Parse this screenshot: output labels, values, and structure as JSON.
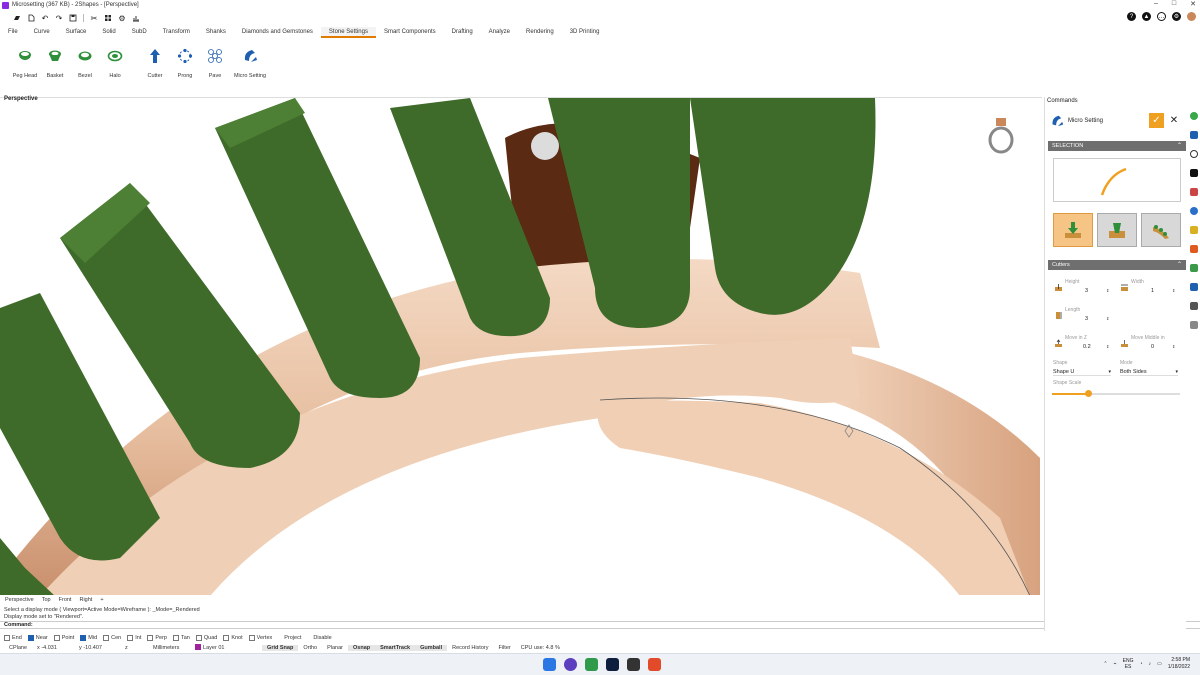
{
  "window": {
    "title": "Microsetting (367 KB) - 2Shapes - [Perspective]",
    "controls": [
      "–",
      "□",
      "✕"
    ]
  },
  "ribbon": {
    "tabs": [
      {
        "label": "File",
        "active": false
      },
      {
        "label": "Curve",
        "active": false
      },
      {
        "label": "Surface",
        "active": false
      },
      {
        "label": "Solid",
        "active": false
      },
      {
        "label": "SubD",
        "active": false
      },
      {
        "label": "Transform",
        "active": false
      },
      {
        "label": "Shanks",
        "active": false
      },
      {
        "label": "Diamonds and Gemstones",
        "active": false
      },
      {
        "label": "Stone Settings",
        "active": true
      },
      {
        "label": "Smart Components",
        "active": false
      },
      {
        "label": "Drafting",
        "active": false
      },
      {
        "label": "Analyze",
        "active": false
      },
      {
        "label": "Rendering",
        "active": false
      },
      {
        "label": "3D Printing",
        "active": false
      }
    ],
    "commands": [
      {
        "label": "Peg Head",
        "icon": "peg-head-icon"
      },
      {
        "label": "Basket",
        "icon": "basket-icon"
      },
      {
        "label": "Bezel",
        "icon": "bezel-icon"
      },
      {
        "label": "Halo",
        "icon": "halo-icon"
      },
      {
        "label": "Cutter",
        "icon": "cutter-icon"
      },
      {
        "label": "Prong",
        "icon": "prong-icon"
      },
      {
        "label": "Pave",
        "icon": "pave-icon"
      },
      {
        "label": "Micro Setting",
        "icon": "micro-setting-icon"
      }
    ]
  },
  "viewport": {
    "label": "Perspective",
    "tabs": [
      "Perspective",
      "Top",
      "Front",
      "Right",
      "+"
    ]
  },
  "history": {
    "line1": "Select a display mode ( Viewport=Active  Mode=Wireframe ): _Mode=_Rendered",
    "line2": "Display mode set to \"Rendered\"."
  },
  "command_prompt": "Command:",
  "osnap": [
    {
      "label": "End",
      "checked": false
    },
    {
      "label": "Near",
      "checked": true
    },
    {
      "label": "Point",
      "checked": false
    },
    {
      "label": "Mid",
      "checked": true
    },
    {
      "label": "Cen",
      "checked": false
    },
    {
      "label": "Int",
      "checked": false
    },
    {
      "label": "Perp",
      "checked": false
    },
    {
      "label": "Tan",
      "checked": false
    },
    {
      "label": "Quad",
      "checked": false
    },
    {
      "label": "Knot",
      "checked": false
    },
    {
      "label": "Vertex",
      "checked": false
    }
  ],
  "osnap_extra": [
    "Project",
    "Disable"
  ],
  "status": {
    "cplane": "CPlane",
    "x": "x -4.031",
    "y": "y -10.407",
    "z": "z",
    "units": "Millimeters",
    "layer": "Layer 01",
    "toggles": [
      {
        "label": "Grid Snap",
        "on": true
      },
      {
        "label": "Ortho",
        "on": false
      },
      {
        "label": "Planar",
        "on": false
      },
      {
        "label": "Osnap",
        "on": true
      },
      {
        "label": "SmartTrack",
        "on": true
      },
      {
        "label": "Gumball",
        "on": true
      },
      {
        "label": "Record History",
        "on": false
      },
      {
        "label": "Filter",
        "on": false
      }
    ],
    "cpu": "CPU use: 4.8 %"
  },
  "panel": {
    "title": "Commands",
    "command_name": "Micro Setting",
    "ok_label": "✓",
    "close_label": "✕",
    "selection_header": "SELECTION",
    "cutters_header": "Cutters",
    "height_label": "Height",
    "height_value": "3",
    "width_label": "Width",
    "width_value": "1",
    "length_label": "Length",
    "length_value": "3",
    "move_z_label": "Move in Z",
    "move_z_value": "0.2",
    "move_middle_label": "Move Middle in",
    "move_middle_value": "0",
    "shape_label": "Shape",
    "shape_value": "Shape U",
    "mode_label": "Mode",
    "mode_value": "Both Sides",
    "shape_scale_label": "Shape Scale",
    "shape_scale_fraction": 0.28
  },
  "taskbar": {
    "lang_top": "ENG",
    "lang_bottom": "ES",
    "time": "2:58 PM",
    "date": "1/18/2022"
  },
  "colors": {
    "accent": "#f0a020",
    "prong_green": "#3f6b2a",
    "rose_gold": "#e9c2a3"
  }
}
